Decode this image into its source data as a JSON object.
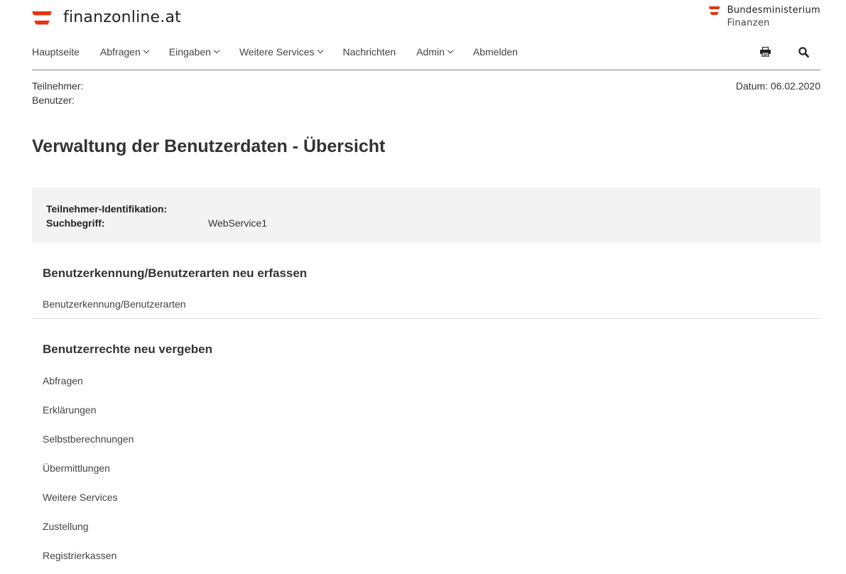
{
  "header": {
    "logo_text": "finanzonline.at",
    "ministry_line1": "Bundesministerium",
    "ministry_line2": "Finanzen",
    "brand_color": "#e6320f"
  },
  "nav": {
    "items": [
      {
        "label": "Hauptseite",
        "dropdown": false
      },
      {
        "label": "Abfragen",
        "dropdown": true
      },
      {
        "label": "Eingaben",
        "dropdown": true
      },
      {
        "label": "Weitere Services",
        "dropdown": true
      },
      {
        "label": "Nachrichten",
        "dropdown": false
      },
      {
        "label": "Admin",
        "dropdown": true
      },
      {
        "label": "Abmelden",
        "dropdown": false
      }
    ],
    "tools": [
      "print-icon",
      "search-icon"
    ]
  },
  "meta": {
    "participant_label": "Teilnehmer:",
    "user_label": "Benutzer:",
    "date_label": "Datum:",
    "date_value": "06.02.2020"
  },
  "page": {
    "title": "Verwaltung der Benutzerdaten - Übersicht"
  },
  "info": {
    "id_label": "Teilnehmer-Identifikation:",
    "id_value": "",
    "search_label": "Suchbegriff:",
    "search_value": "WebService1"
  },
  "section1": {
    "title": "Benutzerkennung/Benutzerarten neu erfassen",
    "link": "Benutzerkennung/Benutzerarten"
  },
  "section2": {
    "title": "Benutzerrechte neu vergeben",
    "links": [
      "Abfragen",
      "Erklärungen",
      "Selbstberechnungen",
      "Übermittlungen",
      "Weitere Services",
      "Zustellung",
      "Registrierkassen"
    ]
  }
}
